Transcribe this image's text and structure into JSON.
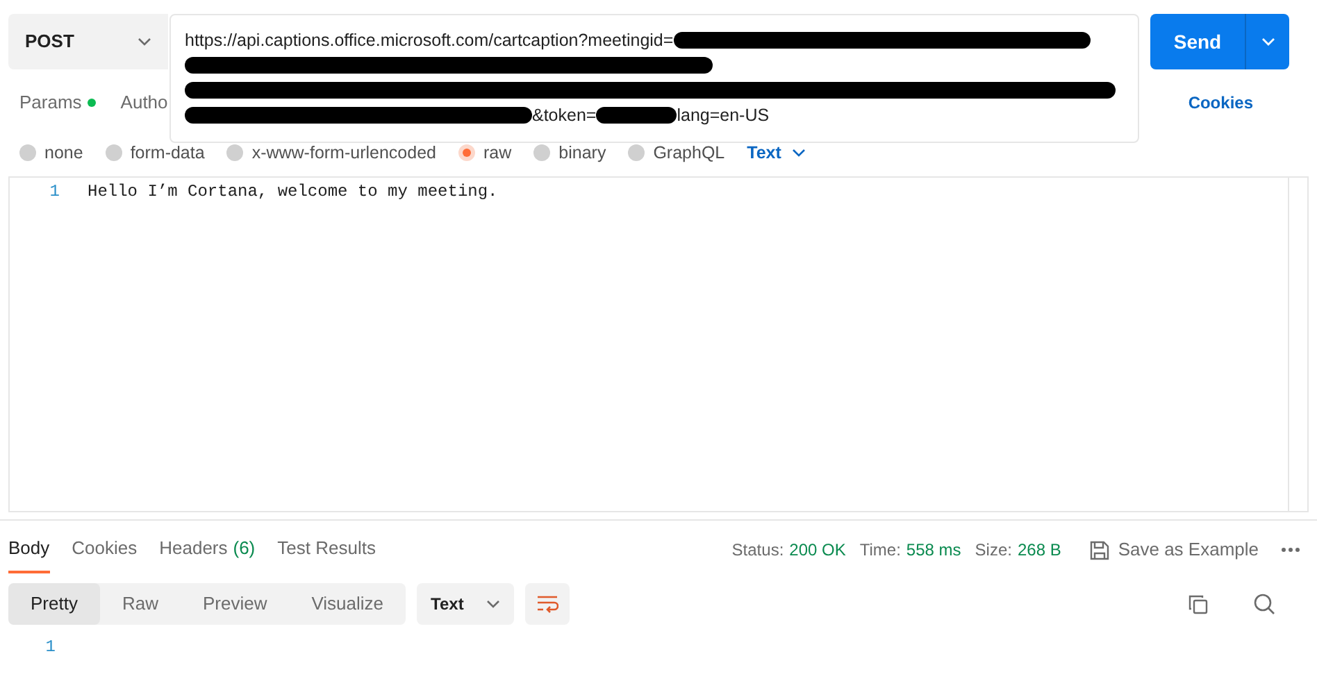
{
  "request": {
    "method": "POST",
    "url_segments": [
      {
        "kind": "text",
        "text": "https://api.captions.office.microsoft.com/cartcaption?meetingid="
      },
      {
        "kind": "redacted"
      },
      {
        "kind": "break"
      },
      {
        "kind": "redacted"
      },
      {
        "kind": "break"
      },
      {
        "kind": "redacted"
      },
      {
        "kind": "break"
      },
      {
        "kind": "redacted"
      },
      {
        "kind": "text",
        "text": "&token="
      },
      {
        "kind": "redacted"
      },
      {
        "kind": "text",
        "text": "lang=en-US"
      }
    ],
    "send_label": "Send"
  },
  "request_tabs": [
    {
      "label": "Params",
      "dot": true,
      "selected": false
    },
    {
      "label": "Autho",
      "selected": false
    }
  ],
  "cookies_link": "Cookies",
  "body_types": [
    {
      "label": "none",
      "selected": false
    },
    {
      "label": "form-data",
      "selected": false
    },
    {
      "label": "x-www-form-urlencoded",
      "selected": false
    },
    {
      "label": "raw",
      "selected": true
    },
    {
      "label": "binary",
      "selected": false
    },
    {
      "label": "GraphQL",
      "selected": false
    }
  ],
  "raw_format": "Text",
  "editor_lines": [
    {
      "number": "1",
      "text": "Hello I’m Cortana, welcome to my meeting."
    }
  ],
  "response_tabs": [
    {
      "label": "Body",
      "selected": true
    },
    {
      "label": "Cookies",
      "selected": false
    },
    {
      "label": "Headers",
      "count": "(6)",
      "selected": false
    },
    {
      "label": "Test Results",
      "selected": false
    }
  ],
  "status": [
    {
      "label": "Status:",
      "value": "200 OK"
    },
    {
      "label": "Time:",
      "value": "558 ms"
    },
    {
      "label": "Size:",
      "value": "268 B"
    }
  ],
  "save_example": "Save as Example",
  "view_modes": [
    {
      "label": "Pretty",
      "selected": true
    },
    {
      "label": "Raw",
      "selected": false
    },
    {
      "label": "Preview",
      "selected": false
    },
    {
      "label": "Visualize",
      "selected": false
    }
  ],
  "response_format": "Text",
  "response_lines": [
    {
      "number": "1"
    }
  ]
}
